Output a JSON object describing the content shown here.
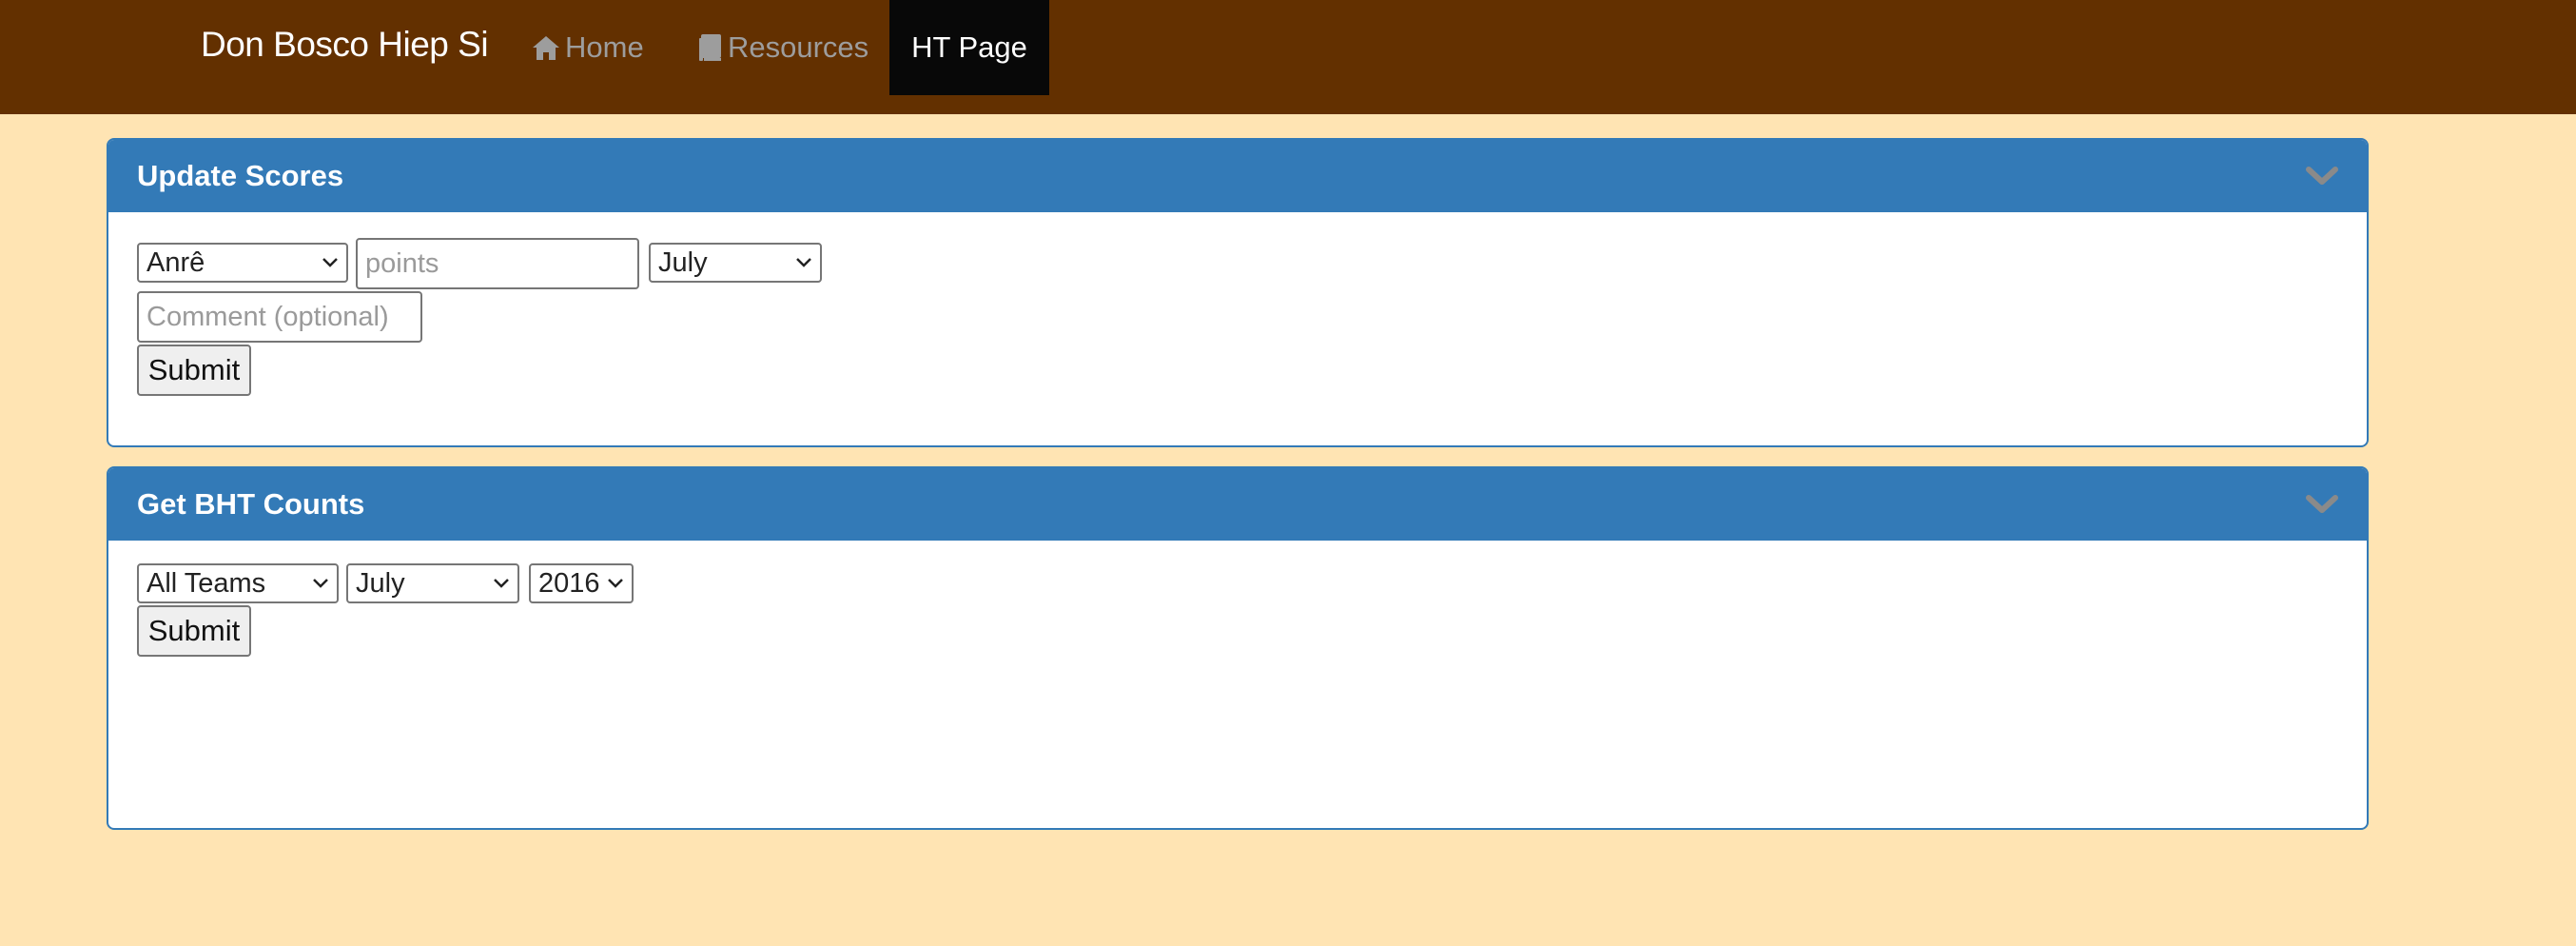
{
  "nav": {
    "brand": "Don Bosco Hiep Si",
    "items": [
      {
        "label": "Home",
        "icon": "home-icon"
      },
      {
        "label": "Resources",
        "icon": "book-icon"
      },
      {
        "label": "HT Page",
        "active": true
      }
    ]
  },
  "panels": {
    "update_scores": {
      "title": "Update Scores",
      "member_select": "Anrê",
      "points_placeholder": "points",
      "month_select": "July",
      "comment_placeholder": "Comment (optional)",
      "submit_label": "Submit"
    },
    "bht_counts": {
      "title": "Get BHT Counts",
      "team_select": "All Teams",
      "month_select": "July",
      "year_select": "2016",
      "submit_label": "Submit"
    }
  },
  "colors": {
    "navbar": "#633000",
    "page_background": "#ffe4b3",
    "panel_primary": "#337ab7",
    "active_nav": "#080808"
  }
}
